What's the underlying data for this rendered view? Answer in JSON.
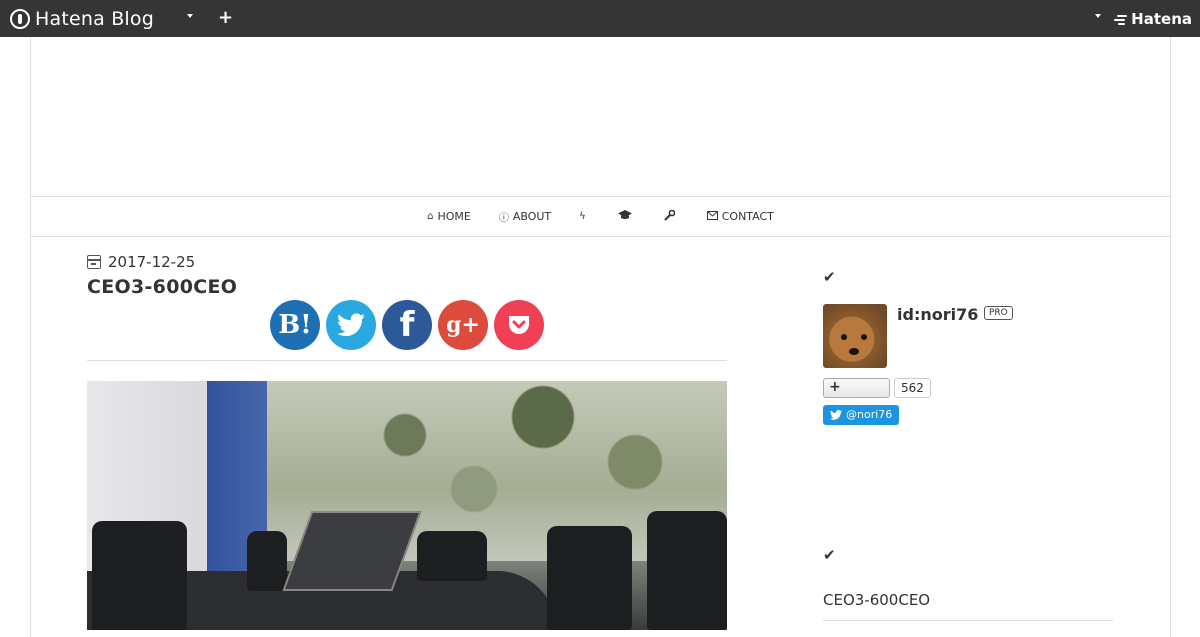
{
  "topbar": {
    "brand": "Hatena Blog",
    "plus_label": "+",
    "right_brand": "Hatena"
  },
  "nav": {
    "items": [
      {
        "label": "HOME",
        "icon": "home-icon"
      },
      {
        "label": "ABOUT",
        "icon": "info-icon"
      },
      {
        "label": "",
        "icon": "bolt-icon"
      },
      {
        "label": "",
        "icon": "graduation-cap-icon"
      },
      {
        "label": "",
        "icon": "wrench-icon"
      },
      {
        "label": "CONTACT",
        "icon": "envelope-icon"
      }
    ]
  },
  "article": {
    "date": "2017-12-25",
    "title": "CEO3-600CEO"
  },
  "share": {
    "hatena": "B!",
    "facebook": "f",
    "googleplus": "g+"
  },
  "sidebar": {
    "profile_check": "✔",
    "user_id": "id:nori76",
    "badge": "PRO",
    "follow_label": "+",
    "follower_count": "562",
    "twitter_label": "@nori76",
    "recent_check": "✔",
    "recent_entry": "CEO3-600CEO"
  },
  "colors": {
    "topbar": "#353535",
    "hatena_bookmark": "#1f6fb5",
    "twitter": "#2aa8e0",
    "facebook": "#2d5998",
    "googleplus": "#dc4b3b",
    "pocket": "#ef4056",
    "twitter_follow": "#1b95e0"
  }
}
